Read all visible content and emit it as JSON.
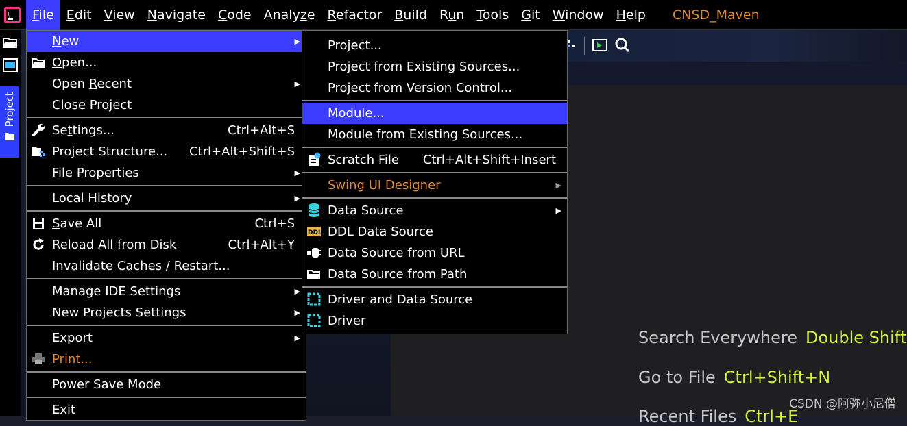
{
  "menubar": {
    "items": [
      {
        "pre": "",
        "u": "F",
        "post": "ile"
      },
      {
        "pre": "",
        "u": "E",
        "post": "dit"
      },
      {
        "pre": "",
        "u": "V",
        "post": "iew"
      },
      {
        "pre": "",
        "u": "N",
        "post": "avigate"
      },
      {
        "pre": "",
        "u": "C",
        "post": "ode"
      },
      {
        "pre": "Analy",
        "u": "z",
        "post": "e"
      },
      {
        "pre": "",
        "u": "R",
        "post": "efactor"
      },
      {
        "pre": "",
        "u": "B",
        "post": "uild"
      },
      {
        "pre": "R",
        "u": "u",
        "post": "n"
      },
      {
        "pre": "",
        "u": "T",
        "post": "ools"
      },
      {
        "pre": "",
        "u": "G",
        "post": "it"
      },
      {
        "pre": "",
        "u": "W",
        "post": "indow"
      },
      {
        "pre": "",
        "u": "H",
        "post": "elp"
      }
    ],
    "project_name": "CNSD_Maven"
  },
  "left_strip": {
    "project_tab": "Project"
  },
  "file_menu": {
    "new": {
      "pre": "",
      "u": "N",
      "post": "ew"
    },
    "open": {
      "pre": "",
      "u": "O",
      "post": "pen..."
    },
    "open_recent": {
      "pre": "Open ",
      "u": "R",
      "post": "ecent"
    },
    "close_project": "Close Project",
    "settings": {
      "pre": "Se",
      "u": "t",
      "post": "tings...",
      "sc": "Ctrl+Alt+S"
    },
    "project_structure": {
      "label": "Project Structure...",
      "sc": "Ctrl+Alt+Shift+S"
    },
    "file_properties": "File Properties",
    "local_history": {
      "pre": "Local ",
      "u": "H",
      "post": "istory"
    },
    "save_all": {
      "pre": "",
      "u": "S",
      "post": "ave All",
      "sc": "Ctrl+S"
    },
    "reload": {
      "label": "Reload All from Disk",
      "sc": "Ctrl+Alt+Y"
    },
    "invalidate": "Invalidate Caches / Restart...",
    "manage_ide": "Manage IDE Settings",
    "new_projects": "New Projects Settings",
    "export": "Export",
    "print": {
      "pre": "",
      "u": "P",
      "post": "rint..."
    },
    "power_save": "Power Save Mode",
    "exit": "Exit"
  },
  "new_menu": {
    "project": "Project...",
    "project_existing": "Project from Existing Sources...",
    "project_vcs": "Project from Version Control...",
    "module": "Module...",
    "module_existing": "Module from Existing Sources...",
    "scratch": {
      "label": "Scratch File",
      "sc": "Ctrl+Alt+Shift+Insert"
    },
    "swing": "Swing UI Designer",
    "data_source": "Data Source",
    "ddl_data_source": "DDL Data Source",
    "data_source_url": "Data Source from URL",
    "data_source_path": "Data Source from Path",
    "driver_and_ds": "Driver and Data Source",
    "driver": "Driver"
  },
  "editor_hints": {
    "search": {
      "label": "Search Everywhere",
      "key": "Double Shift"
    },
    "goto": {
      "label": "Go to File",
      "key": "Ctrl+Shift+N"
    },
    "recent": {
      "label": "Recent Files",
      "key": "Ctrl+E"
    }
  },
  "watermark": "CSDN @阿弥小尼僧",
  "colors": {
    "accent": "#3c3cff",
    "disabled": "#e08a2c",
    "hint_key": "#d7f23c"
  }
}
